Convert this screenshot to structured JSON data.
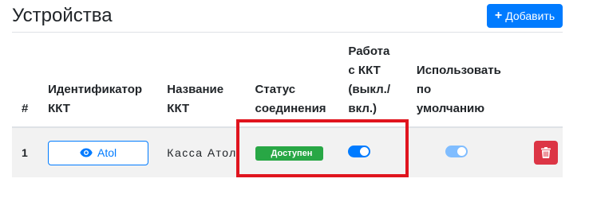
{
  "page": {
    "title": "Устройства",
    "add_button": {
      "icon": "plus-icon",
      "label": "Добавить"
    }
  },
  "table": {
    "headers": {
      "num": "#",
      "id_line1": "Идентификатор",
      "id_line2": "ККТ",
      "name_line1": "Название",
      "name_line2": "ККТ",
      "status_line1": "Статус",
      "status_line2": "соединения",
      "work_line1": "Работа",
      "work_line2": "с ККТ",
      "work_line3": "(выкл./",
      "work_line4": "вкл.)",
      "default_line1": "Использовать",
      "default_line2": "по",
      "default_line3": "умолчанию"
    },
    "rows": [
      {
        "num": "1",
        "device_id": "Atol",
        "device_icon": "eye-icon",
        "name": "Касса Атол",
        "status": "Доступен",
        "work_enabled": true,
        "is_default": true,
        "delete_icon": "trash-icon"
      }
    ]
  },
  "colors": {
    "primary": "#007bff",
    "success": "#28a745",
    "danger": "#dc3545",
    "highlight": "#e0141e"
  }
}
